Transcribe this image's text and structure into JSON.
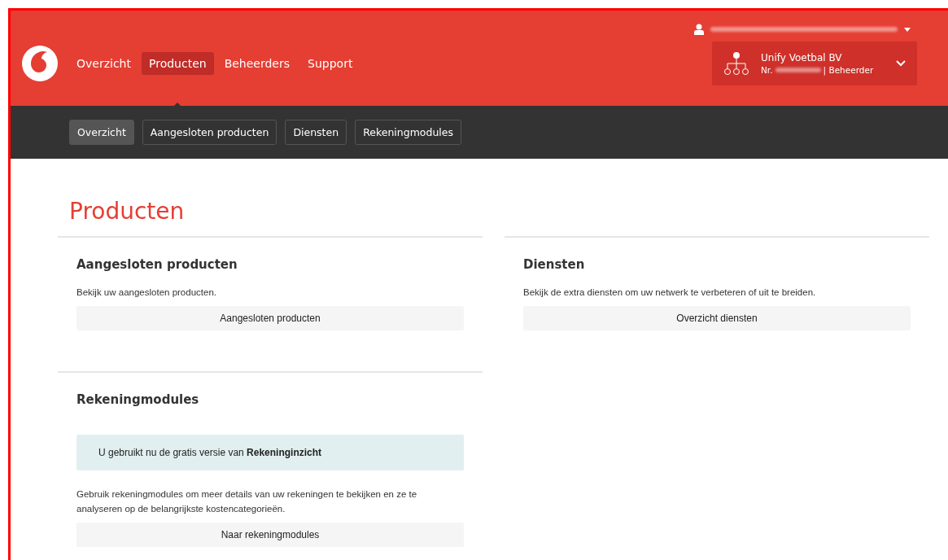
{
  "header": {
    "nav": [
      {
        "label": "Overzicht",
        "selected": false
      },
      {
        "label": "Producten",
        "selected": true
      },
      {
        "label": "Beheerders",
        "selected": false
      },
      {
        "label": "Support",
        "selected": false
      }
    ],
    "account": {
      "name": "Unify Voetbal BV",
      "number_label": "Nr.",
      "role": "| Beheerder"
    }
  },
  "subnav": [
    {
      "label": "Overzicht",
      "selected": true
    },
    {
      "label": "Aangesloten producten",
      "selected": false
    },
    {
      "label": "Diensten",
      "selected": false
    },
    {
      "label": "Rekeningmodules",
      "selected": false
    }
  ],
  "page_title": "Producten",
  "cards": [
    {
      "title": "Aangesloten producten",
      "text": "Bekijk uw aangesloten producten.",
      "button": "Aangesloten producten"
    },
    {
      "title": "Diensten",
      "text": "Bekijk de extra diensten om uw netwerk te verbeteren of uit te breiden.",
      "button": "Overzicht diensten"
    },
    {
      "title": "Rekeningmodules",
      "notice": "U gebruikt nu de gratis versie van **Rekeninginzicht**",
      "text": "Gebruik rekeningmodules om meer details van uw rekeningen te bekijken en ze te analyseren op de belangrijkste kostencategorieën.",
      "button": "Naar rekeningmodules"
    }
  ]
}
